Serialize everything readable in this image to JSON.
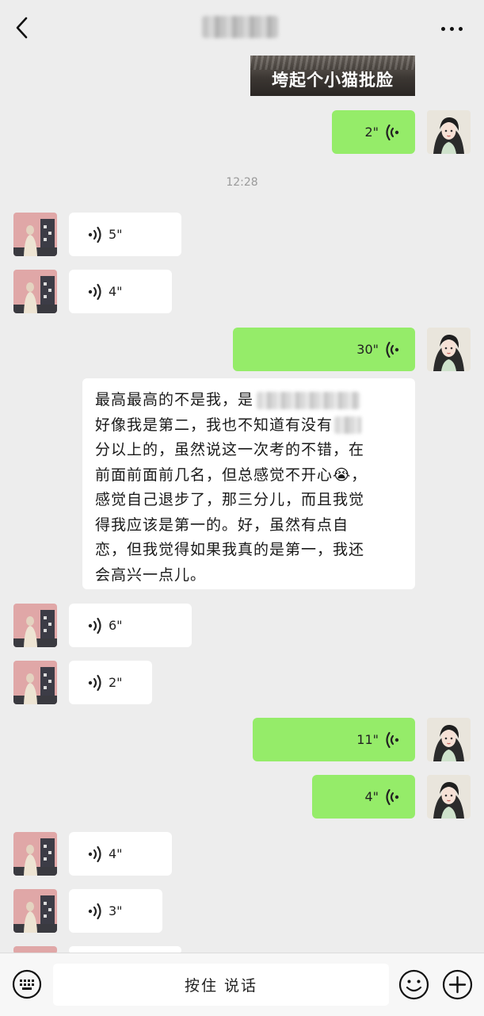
{
  "header": {
    "back_icon": "chevron-left-icon",
    "title": "",
    "more_icon": "more-dots-icon"
  },
  "messages": [
    {
      "id": "m0",
      "type": "image",
      "from": "me",
      "caption": "垮起个小猫批脸"
    },
    {
      "id": "m1",
      "type": "voice",
      "from": "me",
      "duration": "2\""
    },
    {
      "id": "t1",
      "type": "time",
      "text": "12:28"
    },
    {
      "id": "m2",
      "type": "voice",
      "from": "other",
      "duration": "5\""
    },
    {
      "id": "m3",
      "type": "voice",
      "from": "other",
      "duration": "4\""
    },
    {
      "id": "m4",
      "type": "voice",
      "from": "me",
      "duration": "30\""
    },
    {
      "id": "m5",
      "type": "text",
      "from": "me",
      "lines": [
        "最高最高的不是我，是",
        "好像我是第二，我也不知道有没有",
        "分以上的，虽然说这一次考的不错，在",
        "前面前面前几名，但总感觉不开心",
        "感觉自己退步了，那三分儿，而且我觉",
        "得我应该是第一的。好，虽然有点自",
        "恋，但我觉得如果我真的是第一，我还",
        "会高兴一点儿。"
      ],
      "emoji": "😭",
      "emoji_trailing": "，"
    },
    {
      "id": "m6",
      "type": "voice",
      "from": "other",
      "duration": "6\""
    },
    {
      "id": "m7",
      "type": "voice",
      "from": "other",
      "duration": "2\""
    },
    {
      "id": "m8",
      "type": "voice",
      "from": "me",
      "duration": "11\""
    },
    {
      "id": "m9",
      "type": "voice",
      "from": "me",
      "duration": "4\""
    },
    {
      "id": "m10",
      "type": "voice",
      "from": "other",
      "duration": "4\""
    },
    {
      "id": "m11",
      "type": "voice",
      "from": "other",
      "duration": "3\""
    }
  ],
  "input_bar": {
    "keyboard_icon": "keyboard-icon",
    "hold_to_talk": "按住 说话",
    "emoji_icon": "smiley-icon",
    "plus_icon": "plus-circle-icon"
  },
  "colors": {
    "background": "#ededed",
    "outgoing_bubble": "#95ec69",
    "incoming_bubble": "#ffffff"
  }
}
